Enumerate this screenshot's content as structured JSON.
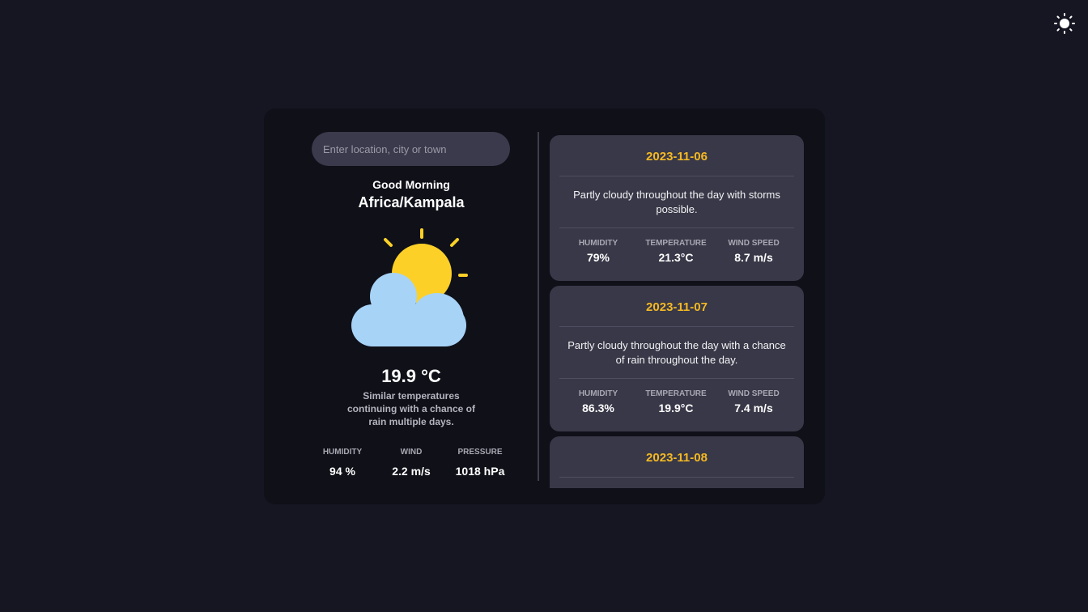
{
  "header": {
    "theme_icon": "sun-icon"
  },
  "search": {
    "placeholder": "Enter location, city or town",
    "value": ""
  },
  "current": {
    "greeting": "Good Morning",
    "location": "Africa/Kampala",
    "icon": "partly-cloudy-icon",
    "temperature": "19.9 °C",
    "description": "Similar temperatures continuing with a chance of rain multiple days.",
    "stats": [
      {
        "label": "HUMIDITY",
        "value": "94 %"
      },
      {
        "label": "WIND",
        "value": "2.2 m/s"
      },
      {
        "label": "PRESSURE",
        "value": "1018 hPa"
      }
    ]
  },
  "forecast": [
    {
      "date": "2023-11-06",
      "description": "Partly cloudy throughout the day with storms possible.",
      "humidity_label": "HUMIDITY",
      "humidity": "79%",
      "temperature_label": "TEMPERATURE",
      "temperature": "21.3°C",
      "wind_label": "WIND SPEED",
      "wind": "8.7 m/s"
    },
    {
      "date": "2023-11-07",
      "description": "Partly cloudy throughout the day with a chance of rain throughout the day.",
      "humidity_label": "HUMIDITY",
      "humidity": "86.3%",
      "temperature_label": "TEMPERATURE",
      "temperature": "19.9°C",
      "wind_label": "WIND SPEED",
      "wind": "7.4 m/s"
    },
    {
      "date": "2023-11-08"
    }
  ],
  "colors": {
    "background": "#151622",
    "panel": "#0f1018",
    "card": "#383848",
    "accent": "#f5b922",
    "sun": "#fcd027",
    "cloud": "#a7d3f7"
  }
}
